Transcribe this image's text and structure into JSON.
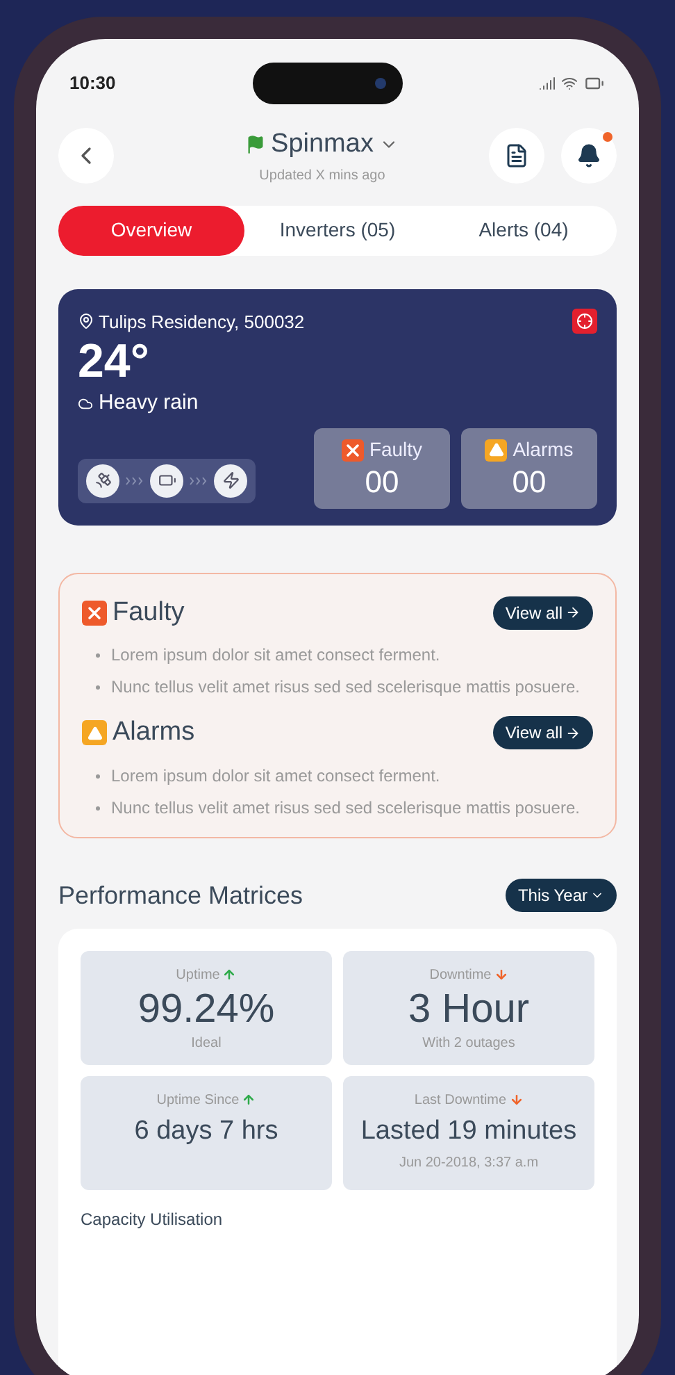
{
  "status_bar": {
    "time": "10:30"
  },
  "header": {
    "title": "Spinmax",
    "subtitle": "Updated X mins ago",
    "notification_unread": true
  },
  "tabs": [
    {
      "label": "Overview",
      "selected": true
    },
    {
      "label": "Inverters (05)",
      "selected": false
    },
    {
      "label": "Alerts (04)",
      "selected": false
    }
  ],
  "weather": {
    "location": "Tulips Residency, 500032",
    "temperature": "24°",
    "condition": "Heavy rain",
    "stats": [
      {
        "kind": "faulty",
        "label": "Faulty",
        "value": "00"
      },
      {
        "kind": "alarm",
        "label": "Alarms",
        "value": "00"
      }
    ]
  },
  "alerts": [
    {
      "kind": "faulty",
      "title": "Faulty",
      "button": "View all",
      "items": [
        "Lorem ipsum dolor sit amet consect ferment.",
        "Nunc tellus velit amet risus sed sed scelerisque mattis posuere."
      ]
    },
    {
      "kind": "alarm",
      "title": "Alarms",
      "button": "View all",
      "items": [
        "Lorem ipsum dolor sit amet consect ferment.",
        "Nunc tellus velit amet risus sed sed scelerisque mattis posuere."
      ]
    }
  ],
  "performance": {
    "title": "Performance Matrices",
    "period": "This Year",
    "metrics": [
      {
        "kind": "uptime",
        "label": "Uptime",
        "value": "99.24%",
        "note": "Ideal"
      },
      {
        "kind": "downtime",
        "label": "Downtime",
        "value": "3 Hour",
        "note": "With 2 outages"
      },
      {
        "kind": "since",
        "label": "Uptime Since",
        "value": "6 days 7 hrs"
      },
      {
        "kind": "last",
        "label": "Last Downtime",
        "value": "Lasted 19 minutes",
        "note": "Jun 20-2018, 3:37 a.m"
      }
    ],
    "footer": "Capacity Utilisation"
  }
}
